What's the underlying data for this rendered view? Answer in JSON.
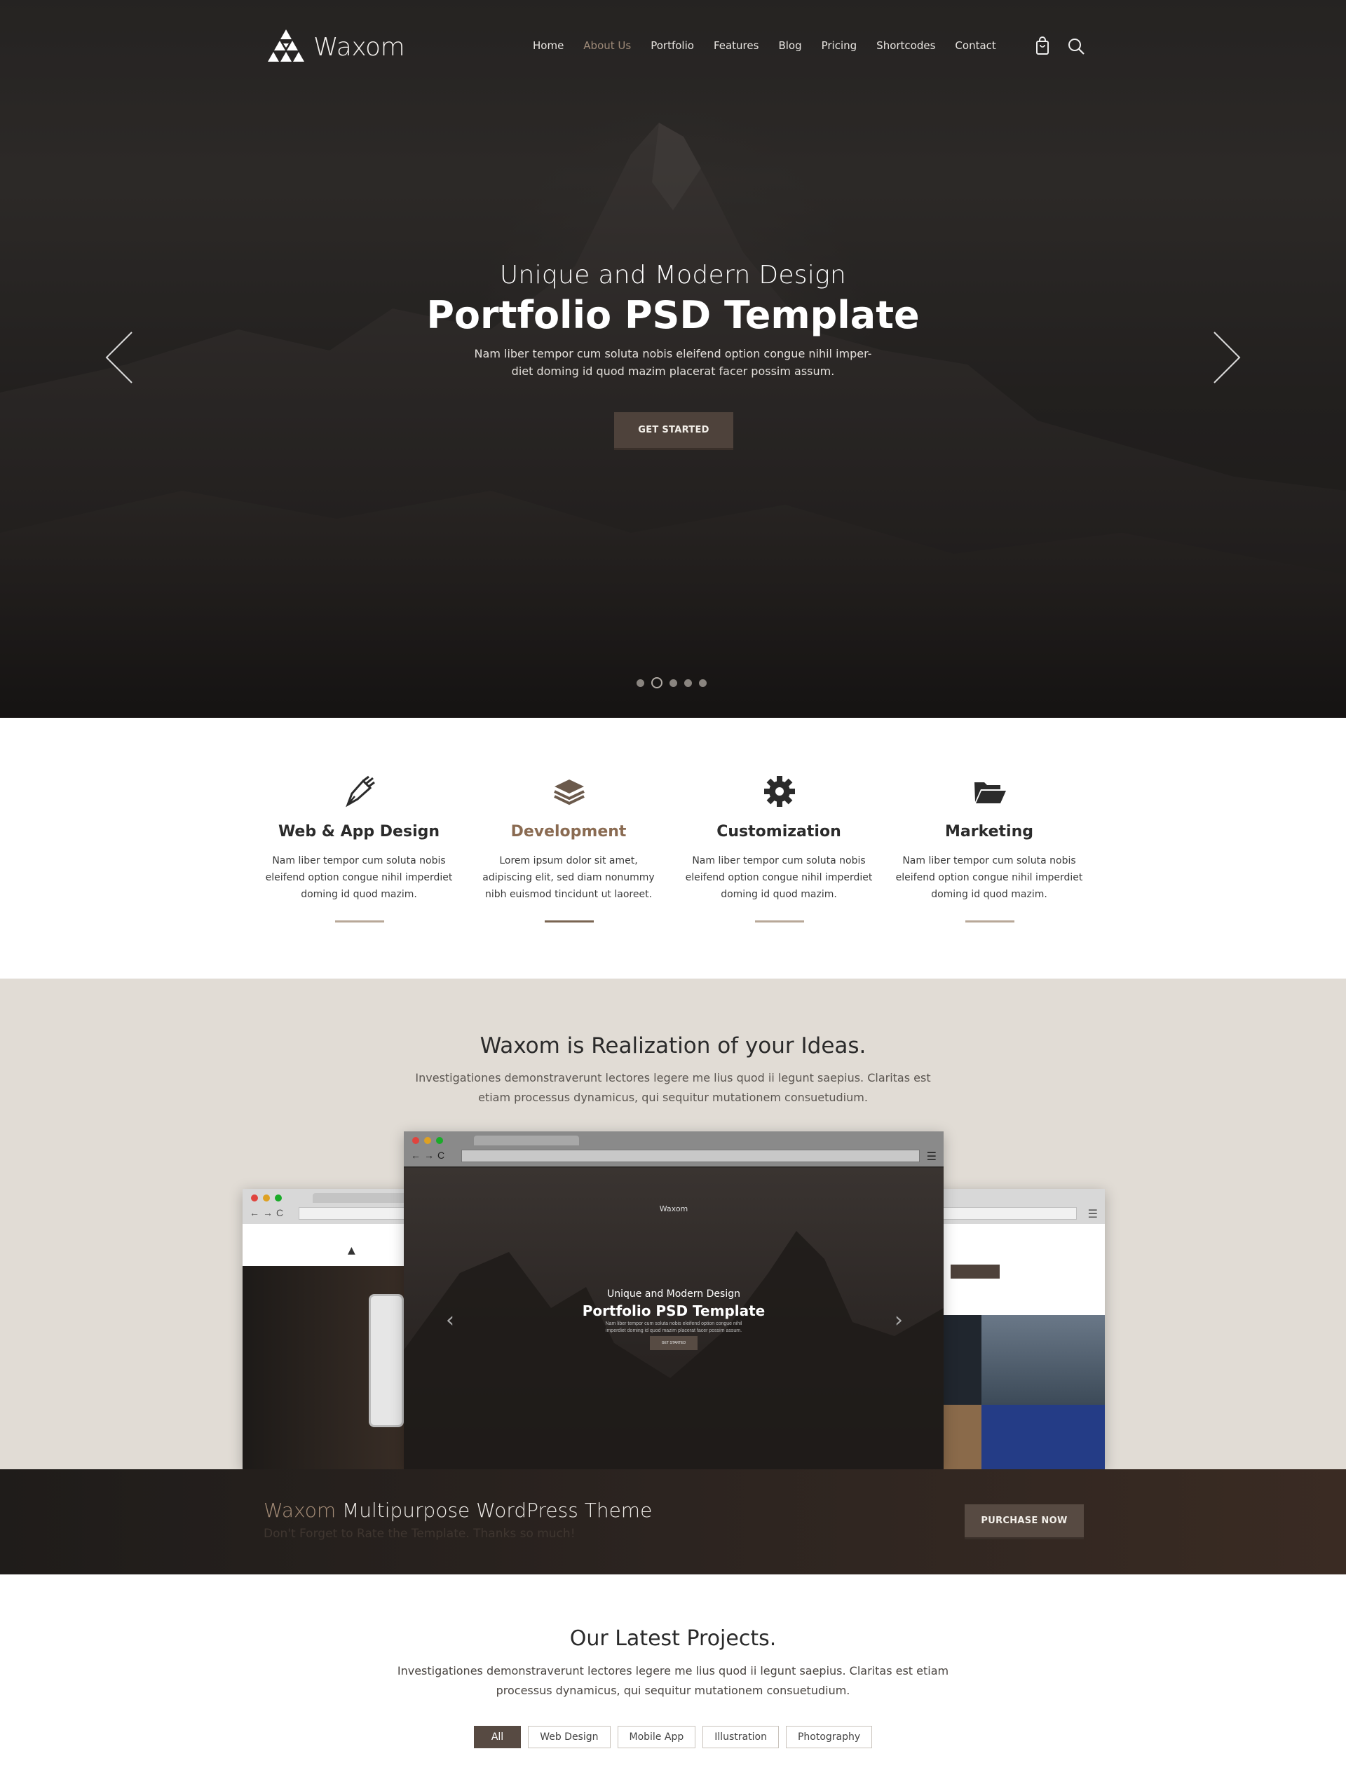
{
  "brand": {
    "name": "Waxom"
  },
  "nav": {
    "items": [
      "Home",
      "About Us",
      "Portfolio",
      "Features",
      "Blog",
      "Pricing",
      "Shortcodes",
      "Contact"
    ],
    "active_index": 1,
    "icons": [
      "shopping-bag-icon",
      "search-icon"
    ]
  },
  "hero": {
    "subtitle": "Unique and Modern Design",
    "title": "Portfolio PSD Template",
    "description": "Nam liber tempor cum soluta nobis eleifend option congue nihil imper-diet doming id quod mazim placerat facer possim assum.",
    "button": "GET STARTED",
    "slides": 5,
    "active_slide": 2
  },
  "services": [
    {
      "icon": "pen-nib-icon",
      "title": "Web & App Design",
      "text": "Nam liber tempor cum soluta nobis eleifend option congue nihil imperdiet doming id quod mazim.",
      "highlighted": false
    },
    {
      "icon": "layers-icon",
      "title": "Development",
      "text": "Lorem ipsum dolor sit amet, adipiscing elit, sed diam nonummy nibh euismod tincidunt ut laoreet.",
      "highlighted": true
    },
    {
      "icon": "gear-icon",
      "title": "Customization",
      "text": "Nam liber tempor cum soluta nobis eleifend option congue nihil imperdiet doming id quod mazim.",
      "highlighted": false
    },
    {
      "icon": "folder-open-icon",
      "title": "Marketing",
      "text": "Nam liber tempor cum soluta nobis eleifend option congue nihil imperdiet doming id quod mazim.",
      "highlighted": false
    }
  ],
  "showcase": {
    "title": "Waxom is Realization of your Ideas.",
    "text": "Investigationes demonstraverunt lectores legere me lius quod ii legunt saepius. Claritas est etiam processus dynamicus, qui sequitur mutationem consuetudium.",
    "mock": {
      "logo": "Waxom",
      "subtitle": "Unique and Modern Design",
      "title": "Portfolio PSD Template",
      "description": "Nam liber tempor cum soluta nobis eleifend option congue nihil imperdiet doming id quod mazim placerat facer possim assum.",
      "button": "GET STARTED"
    }
  },
  "cta": {
    "brand": "Waxom",
    "title": "Multipurpose WordPress Theme",
    "subtitle": "Don't Forget to Rate the Template. Thanks so much!",
    "button": "PURCHASE NOW"
  },
  "projects": {
    "title": "Our Latest Projects.",
    "text": "Investigationes demonstraverunt lectores legere me lius quod ii legunt saepius. Claritas est etiam processus dynamicus, qui sequitur mutationem consuetudium.",
    "filters": [
      "All",
      "Web Design",
      "Mobile App",
      "Illustration",
      "Photography"
    ],
    "active_filter": 0
  },
  "colors": {
    "accent": "#8a6b52",
    "button": "#574a42",
    "showcase_bg": "#e1dcd5",
    "hero_bg": "#2a2826"
  }
}
